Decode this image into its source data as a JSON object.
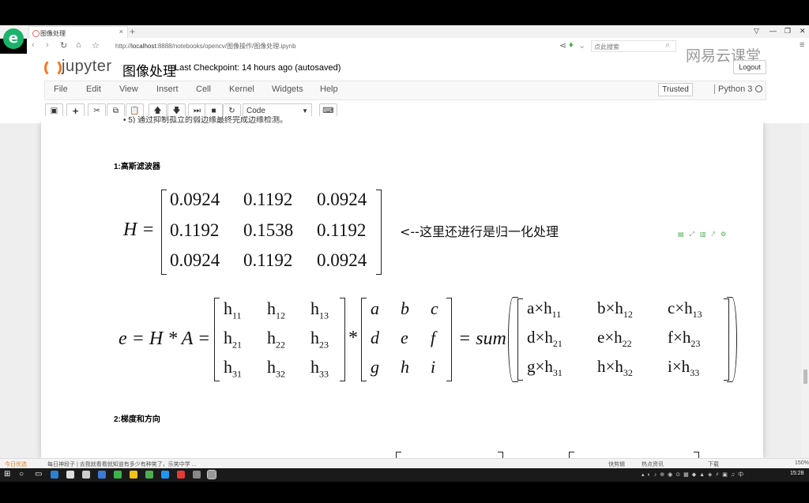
{
  "browser": {
    "tab_title": "图像处理",
    "new_tab": "+",
    "url_prefix": "http://",
    "url_host": "localhost",
    "url_rest": ":8888/notebooks/opencv/图像操作/图像处理.ipynb",
    "search_placeholder": "点此搜索",
    "logo": "e"
  },
  "jupyter": {
    "logo_text": "jupyter",
    "notebook_name": "图像处理",
    "checkpoint": "Last Checkpoint: 14 hours ago (autosaved)",
    "logout": "Logout",
    "watermark": "网易云课堂",
    "menu": [
      "File",
      "Edit",
      "View",
      "Insert",
      "Cell",
      "Kernel",
      "Widgets",
      "Help"
    ],
    "trusted": "Trusted",
    "kernel": "Python 3",
    "celltype": "Code",
    "toolbar_icons": [
      "save-icon",
      "plus-icon",
      "cut-icon",
      "copy-icon",
      "paste-icon",
      "arrow-up-icon",
      "arrow-down-icon",
      "run-icon",
      "stop-icon",
      "restart-icon",
      "keyboard-icon"
    ]
  },
  "notebook": {
    "cut_text": "5) 通过抑制孤立的弱边缘最终完成边缘检测。",
    "heading1": "1:高斯滤波器",
    "heading2": "2:梯度和方向",
    "annotation": "<--这里还进行是归一化处理",
    "H_label": "H =",
    "H": [
      [
        "0.0924",
        "0.1192",
        "0.0924"
      ],
      [
        "0.1192",
        "0.1538",
        "0.1192"
      ],
      [
        "0.0924",
        "0.1192",
        "0.0924"
      ]
    ],
    "e_label": "e = H * A =",
    "h_base": "h",
    "h_subs": [
      [
        "11",
        "12",
        "13"
      ],
      [
        "21",
        "22",
        "23"
      ],
      [
        "31",
        "32",
        "33"
      ]
    ],
    "star": "*",
    "A": [
      [
        "a",
        "b",
        "c"
      ],
      [
        "d",
        "e",
        "f"
      ],
      [
        "g",
        "h",
        "i"
      ]
    ],
    "sum_label": "= sum",
    "prod_vars": [
      [
        "a",
        "b",
        "c"
      ],
      [
        "d",
        "e",
        "f"
      ],
      [
        "g",
        "h",
        "i"
      ]
    ],
    "times": "×"
  },
  "statusbar": {
    "left": "今日优选",
    "news": "每日神段子 | 去我就看看就知道有多少有种笑了，乐笑中学 ... ",
    "right_items": [
      "快剪辑",
      "热点资讯",
      "下载"
    ],
    "zoom": "150%"
  },
  "taskbar": {
    "time": "15:28"
  }
}
